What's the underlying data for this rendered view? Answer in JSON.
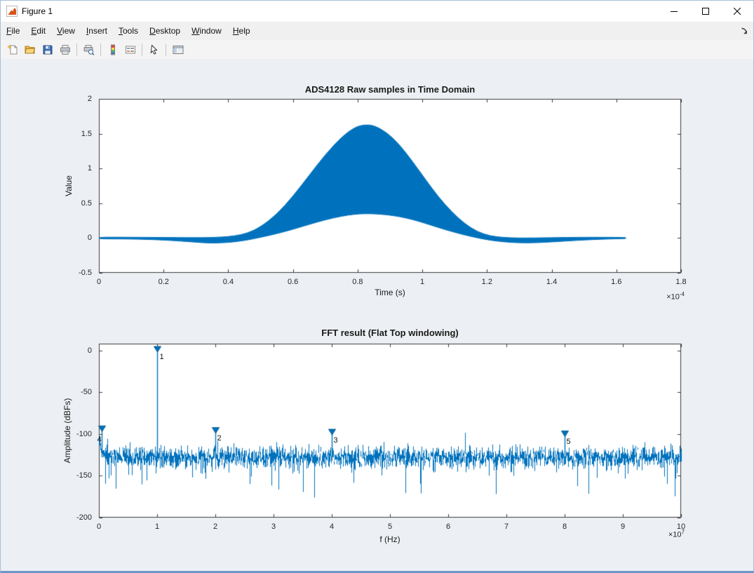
{
  "window": {
    "title": "Figure 1"
  },
  "menubar": {
    "items": [
      {
        "label": "File",
        "underline": 0
      },
      {
        "label": "Edit",
        "underline": 0
      },
      {
        "label": "View",
        "underline": 0
      },
      {
        "label": "Insert",
        "underline": 0
      },
      {
        "label": "Tools",
        "underline": 0
      },
      {
        "label": "Desktop",
        "underline": 0
      },
      {
        "label": "Window",
        "underline": 0
      },
      {
        "label": "Help",
        "underline": 0
      }
    ]
  },
  "toolbar": {
    "buttons": [
      "new-figure",
      "open-file",
      "save-figure",
      "print-figure",
      "print-preview",
      "insert-colorbar",
      "insert-legend",
      "edit-plot",
      "show-plot-tools"
    ]
  },
  "chart_data": [
    {
      "type": "line",
      "title": "ADS4128 Raw samples in Time Domain",
      "xlabel": "Time (s)",
      "ylabel": "Value",
      "x_exponent": {
        "base": "×10",
        "exp": "-4"
      },
      "xlim": [
        0,
        1.8
      ],
      "ylim": [
        -0.5,
        2
      ],
      "xticks": [
        0,
        0.2,
        0.4,
        0.6,
        0.8,
        1,
        1.2,
        1.4,
        1.6,
        1.8
      ],
      "xtick_labels": [
        "0",
        "0.2",
        "0.4",
        "0.6",
        "0.8",
        "1",
        "1.2",
        "1.4",
        "1.6",
        "1.8"
      ],
      "yticks": [
        -0.5,
        0,
        0.5,
        1,
        1.5,
        2
      ],
      "ytick_labels": [
        "-0.5",
        "0",
        "0.5",
        "1",
        "1.5",
        "2"
      ],
      "line_color": "#0072BD",
      "envelope": [
        [
          0,
          0.012,
          -0.012
        ],
        [
          0.06,
          0.012,
          -0.013
        ],
        [
          0.12,
          0.011,
          -0.016
        ],
        [
          0.18,
          0.009,
          -0.024
        ],
        [
          0.24,
          0.007,
          -0.04
        ],
        [
          0.3,
          0.005,
          -0.06
        ],
        [
          0.34,
          0.007,
          -0.072
        ],
        [
          0.38,
          0.014,
          -0.07
        ],
        [
          0.42,
          0.03,
          -0.055
        ],
        [
          0.46,
          0.07,
          -0.028
        ],
        [
          0.5,
          0.16,
          0.01
        ],
        [
          0.55,
          0.34,
          0.062
        ],
        [
          0.6,
          0.6,
          0.125
        ],
        [
          0.65,
          0.9,
          0.196
        ],
        [
          0.7,
          1.2,
          0.262
        ],
        [
          0.75,
          1.45,
          0.315
        ],
        [
          0.79,
          1.59,
          0.342
        ],
        [
          0.82,
          1.63,
          0.35
        ],
        [
          0.85,
          1.62,
          0.349
        ],
        [
          0.89,
          1.52,
          0.335
        ],
        [
          0.93,
          1.34,
          0.308
        ],
        [
          0.97,
          1.1,
          0.266
        ],
        [
          1.01,
          0.84,
          0.21
        ],
        [
          1.05,
          0.59,
          0.15
        ],
        [
          1.09,
          0.38,
          0.095
        ],
        [
          1.13,
          0.21,
          0.045
        ],
        [
          1.17,
          0.09,
          0.002
        ],
        [
          1.21,
          0.03,
          -0.032
        ],
        [
          1.25,
          0.008,
          -0.055
        ],
        [
          1.3,
          0,
          -0.07
        ],
        [
          1.35,
          0.002,
          -0.068
        ],
        [
          1.4,
          0.006,
          -0.056
        ],
        [
          1.45,
          0.009,
          -0.042
        ],
        [
          1.5,
          0.011,
          -0.028
        ],
        [
          1.55,
          0.011,
          -0.018
        ],
        [
          1.6,
          0.01,
          -0.011
        ],
        [
          1.63,
          0.008,
          -0.008
        ]
      ]
    },
    {
      "type": "line",
      "title": "FFT result (Flat Top windowing)",
      "xlabel": "f (Hz)",
      "ylabel": "Amplitude (dBFs)",
      "x_exponent": {
        "base": "×10",
        "exp": "7"
      },
      "xlim": [
        0,
        10
      ],
      "ylim": [
        -200,
        8
      ],
      "xticks": [
        0,
        1,
        2,
        3,
        4,
        5,
        6,
        7,
        8,
        9,
        10
      ],
      "xtick_labels": [
        "0",
        "1",
        "2",
        "3",
        "4",
        "5",
        "6",
        "7",
        "8",
        "9",
        "10"
      ],
      "yticks": [
        0,
        -50,
        -100,
        -150,
        -200
      ],
      "ytick_labels": [
        "0",
        "-50",
        "-100",
        "-150",
        "-200"
      ],
      "line_color": "#0072BD",
      "marker_color": "#0072BD",
      "noise": {
        "seed": 20140916,
        "mean": -128,
        "std": 6.5,
        "dc_level": -102,
        "dc_decay": 0.06
      },
      "peaks": [
        {
          "label": "1",
          "x": 1,
          "y": 0,
          "label_offset": [
            3,
            4
          ]
        },
        {
          "label": "2",
          "x": 2,
          "y": -97,
          "label_offset": [
            2,
            5
          ]
        },
        {
          "label": "3",
          "x": 4,
          "y": -99,
          "label_offset": [
            2,
            5
          ]
        },
        {
          "label": "4",
          "x": 0.05,
          "y": -95,
          "label_offset": [
            -7,
            9
          ]
        },
        {
          "label": "5",
          "x": 8,
          "y": -101,
          "label_offset": [
            2,
            5
          ]
        }
      ]
    }
  ]
}
